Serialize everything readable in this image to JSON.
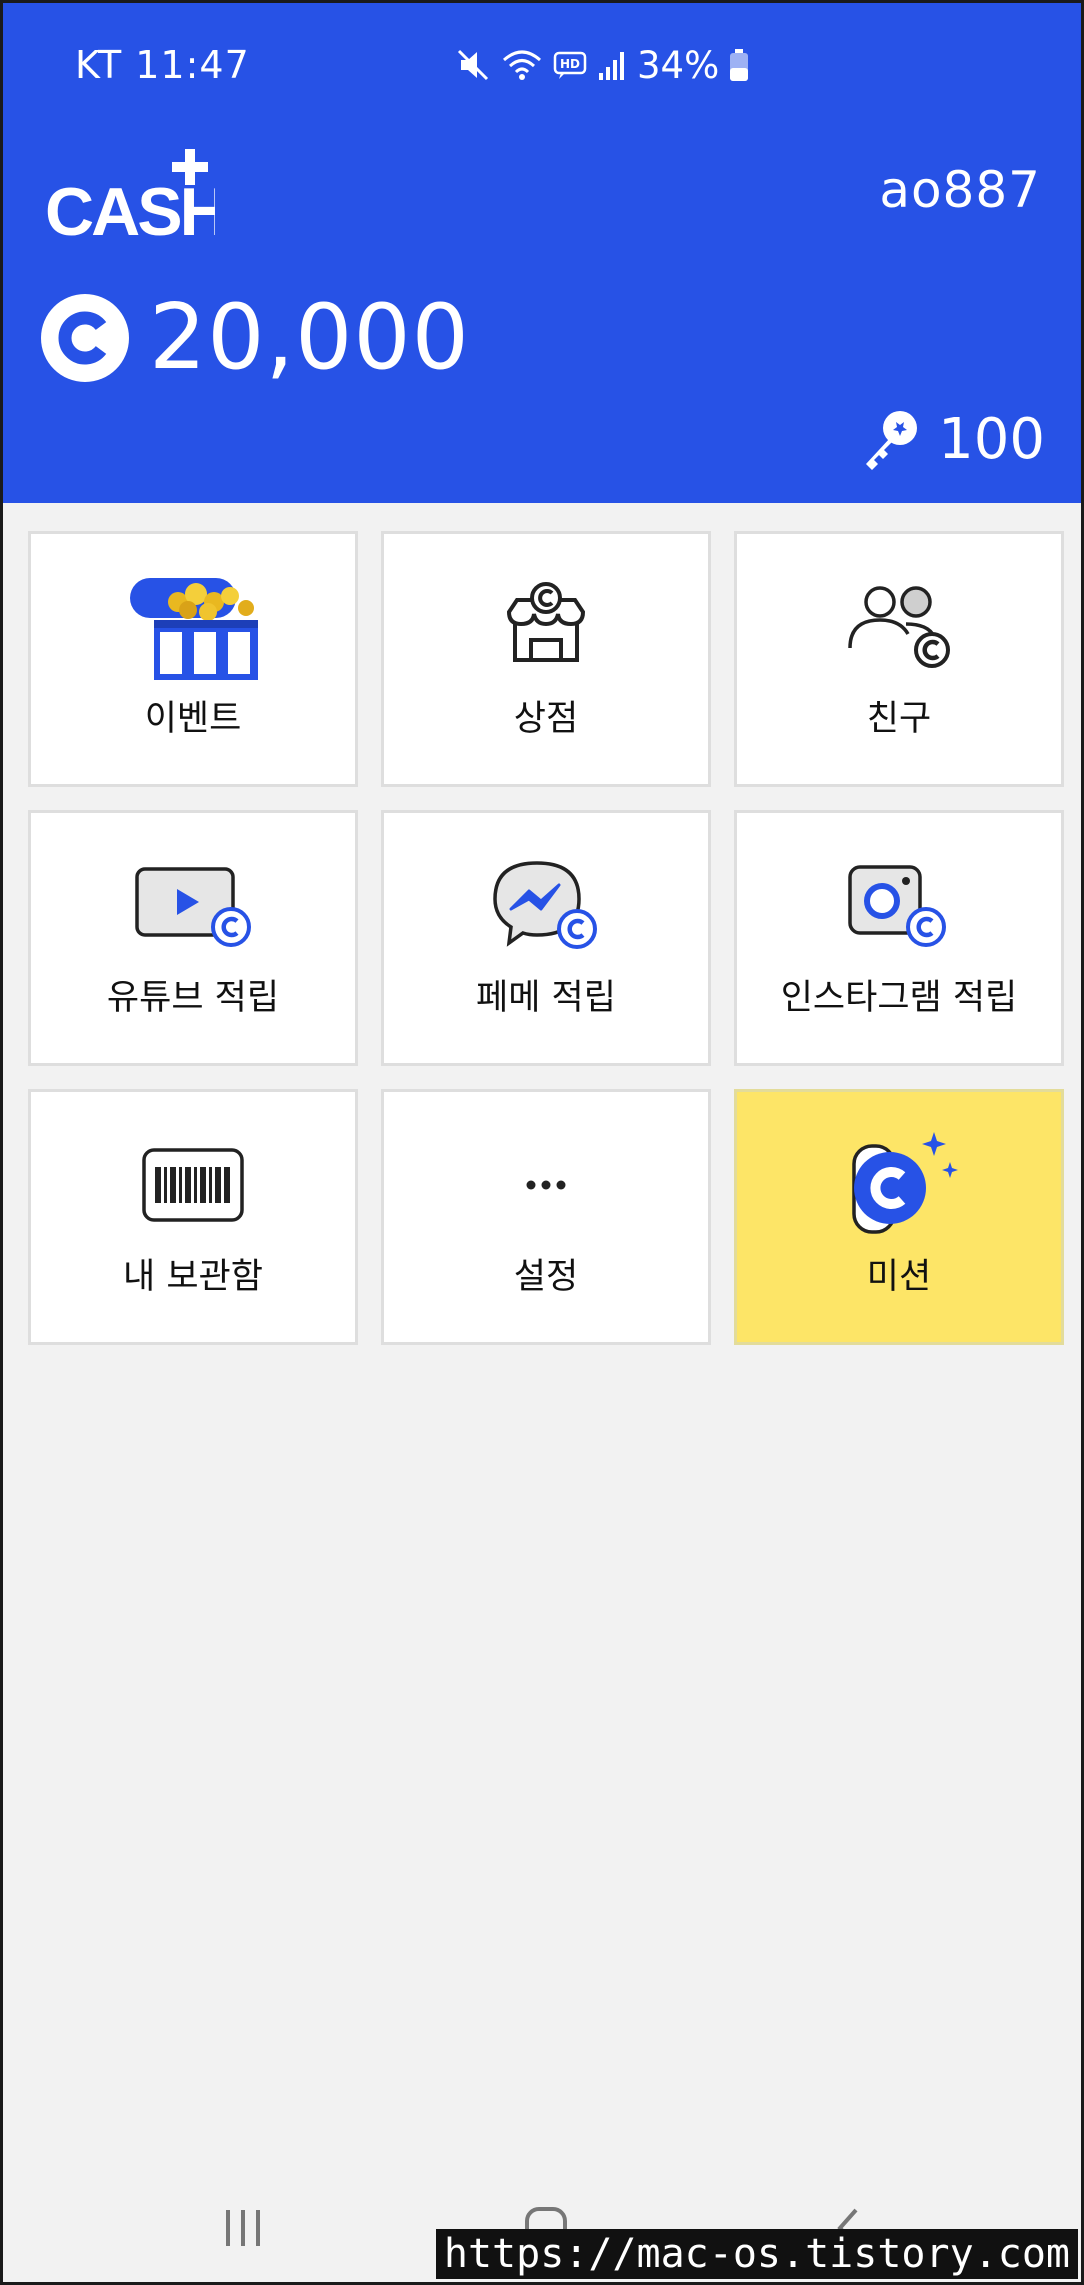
{
  "status_bar": {
    "carrier_time": "KT 11:47",
    "battery": "34%"
  },
  "header": {
    "logo_text": "CASH",
    "username": "ao887",
    "coin_amount": "20,000",
    "key_count": "100"
  },
  "menu": [
    {
      "label": "이벤트",
      "icon": "treasure-chest-icon"
    },
    {
      "label": "상점",
      "icon": "shop-icon"
    },
    {
      "label": "친구",
      "icon": "friends-icon"
    },
    {
      "label": "유튜브 적립",
      "icon": "youtube-play-icon"
    },
    {
      "label": "페메 적립",
      "icon": "messenger-icon"
    },
    {
      "label": "인스타그램 적립",
      "icon": "instagram-icon"
    },
    {
      "label": "내 보관함",
      "icon": "barcode-icon"
    },
    {
      "label": "설정",
      "icon": "more-dots-icon"
    },
    {
      "label": "미션",
      "icon": "mission-coin-icon"
    }
  ],
  "watermark": "https://mac-os.tistory.com",
  "colors": {
    "brand_blue": "#2752e6",
    "mission_yellow": "#fde567",
    "background": "#f2f2f2"
  }
}
